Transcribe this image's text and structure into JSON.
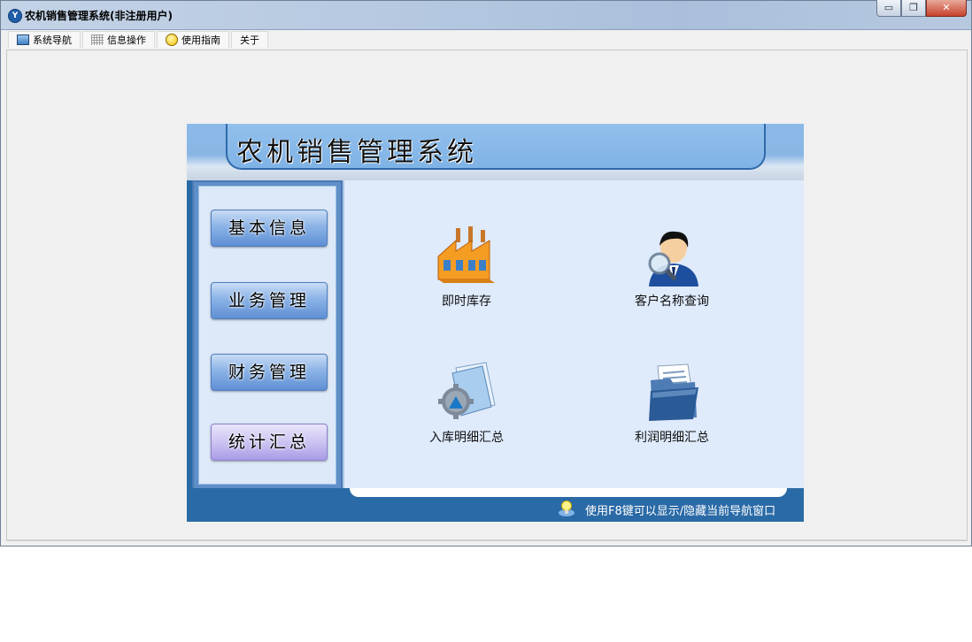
{
  "window": {
    "title": "农机销售管理系统(非注册用户)"
  },
  "menu": {
    "tabs": [
      {
        "label": "系统导航",
        "icon": "monitor-icon"
      },
      {
        "label": "信息操作",
        "icon": "grid-icon"
      },
      {
        "label": "使用指南",
        "icon": "help-icon"
      },
      {
        "label": "关于"
      }
    ]
  },
  "panel": {
    "title": "农机销售管理系统",
    "nav": [
      "基本信息",
      "业务管理",
      "财务管理",
      "统计汇总"
    ],
    "tiles": [
      {
        "label": "即时库存",
        "icon": "factory-icon"
      },
      {
        "label": "客户名称查询",
        "icon": "customer-search-icon"
      },
      {
        "label": "入库明细汇总",
        "icon": "gear-document-icon"
      },
      {
        "label": "利润明细汇总",
        "icon": "folder-documents-icon"
      }
    ],
    "footer_hint": "使用F8键可以显示/隐藏当前导航窗口"
  },
  "colors": {
    "accent": "#2a6aa6",
    "banner": "#8bb9e8",
    "main_bg": "#dfeafb"
  }
}
